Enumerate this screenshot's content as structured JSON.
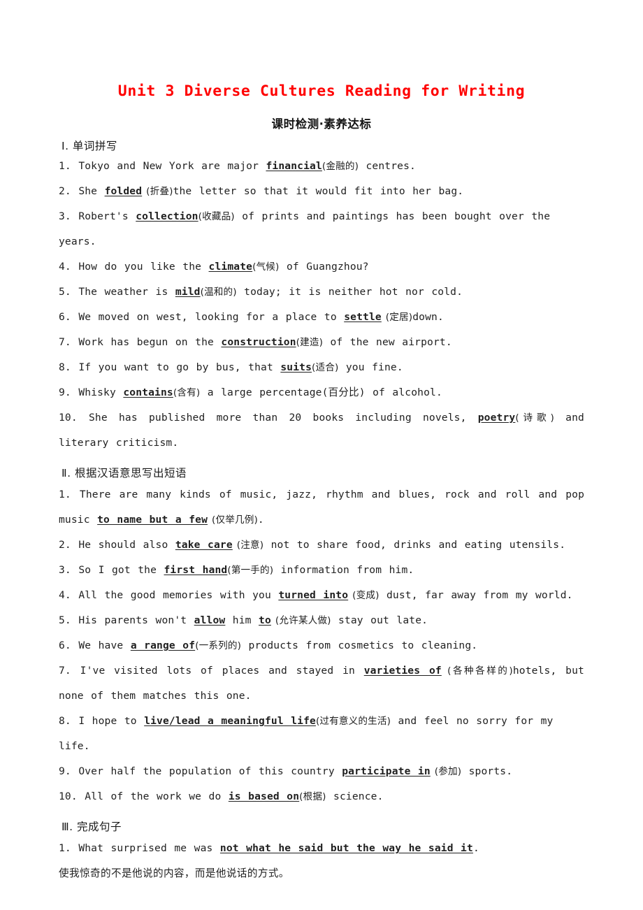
{
  "document": {
    "title": "Unit 3 Diverse Cultures Reading for Writing",
    "subtitle": "课时检测·素养达标",
    "title_color": "#ff0000",
    "subtitle_color": "#141414"
  },
  "sections": [
    {
      "heading": "Ⅰ. 单词拼写",
      "items": [
        {
          "num": "1.",
          "pre": "Tokyo and New York are major ",
          "answer": "financial",
          "gloss": "(金融的)",
          "post": " centres."
        },
        {
          "num": "2.",
          "pre": "She ",
          "answer": "folded",
          "gloss": " (折叠)",
          "post": "the letter so that it would fit into her bag."
        },
        {
          "num": "3.",
          "pre": "Robert's ",
          "answer": "collection",
          "gloss": "(收藏品)",
          "post": " of prints and paintings has been bought over the years."
        },
        {
          "num": "4.",
          "pre": "How do you like the ",
          "answer": "climate",
          "gloss": "(气候)",
          "post": " of Guangzhou?"
        },
        {
          "num": "5.",
          "pre": "The weather is ",
          "answer": "mild",
          "gloss": "(温和的)",
          "post": " today; it is neither hot nor cold."
        },
        {
          "num": "6.",
          "pre": "We moved on west, looking for a place to ",
          "answer": "settle",
          "gloss": " (定居)",
          "post": "down."
        },
        {
          "num": "7.",
          "pre": "Work has begun on the ",
          "answer": "construction",
          "gloss": "(建造)",
          "post": " of the new airport."
        },
        {
          "num": "8.",
          "pre": "If you want to go by bus, that ",
          "answer": "suits",
          "gloss": "(适合)",
          "post": " you fine."
        },
        {
          "num": "9.",
          "pre": "Whisky ",
          "answer": "contains",
          "gloss": "(含有)",
          "post": " a large percentage(百分比) of alcohol."
        },
        {
          "num": "10.",
          "pre": "She has published more than 20 books including novels, ",
          "answer": "poetry",
          "gloss": "(诗歌)",
          "post": " and literary criticism.",
          "justify": true
        }
      ]
    },
    {
      "heading": "Ⅱ. 根据汉语意思写出短语",
      "items": [
        {
          "num": "1.",
          "pre": "There are many kinds of music, jazz, rhythm and blues, rock and roll and pop music ",
          "answer": "to name but a few",
          "gloss": " (仅举几例)",
          "post": ".",
          "justify": true
        },
        {
          "num": "2.",
          "pre": "He should also ",
          "answer": "take care",
          "gloss": " (注意)",
          "post": " not to share food, drinks and eating utensils."
        },
        {
          "num": "3.",
          "pre": "So I got the ",
          "answer": "first hand",
          "gloss": "(第一手的)",
          "post": " information from him."
        },
        {
          "num": "4.",
          "pre": "All the good memories with you ",
          "answer": "turned into",
          "gloss": " (变成)",
          "post": " dust, far away from my world."
        },
        {
          "num": "5.",
          "pre": "His parents won't ",
          "answer": "allow",
          "mid": " him ",
          "answer2": "to",
          "gloss": " (允许某人做)",
          "post": " stay out late."
        },
        {
          "num": "6.",
          "pre": "We have ",
          "answer": "a range of",
          "gloss": "(一系列的)",
          "post": " products from cosmetics to cleaning."
        },
        {
          "num": "7.",
          "pre": "I've visited lots of places and stayed in ",
          "answer": "varieties of",
          "gloss": " (各种各样的)",
          "post": "hotels, but none of them matches this one.",
          "justify": true
        },
        {
          "num": "8.",
          "pre": "I hope to ",
          "answer": "live/lead a meaningful life",
          "gloss": "(过有意义的生活)",
          "post": " and feel no sorry for my life."
        },
        {
          "num": "9.",
          "pre": "Over half the population of this country ",
          "answer": "participate in",
          "gloss": " (参加)",
          "post": " sports."
        },
        {
          "num": "10.",
          "pre": "All of the work we do ",
          "answer": "is based on",
          "gloss": "(根据)",
          "post": " science."
        }
      ]
    },
    {
      "heading": "Ⅲ. 完成句子",
      "items": [
        {
          "num": "1.",
          "pre": "What surprised me was ",
          "answer": "not what he said but the way he said it",
          "gloss": "",
          "post": "."
        }
      ],
      "translation": "使我惊奇的不是他说的内容，而是他说话的方式。"
    }
  ]
}
